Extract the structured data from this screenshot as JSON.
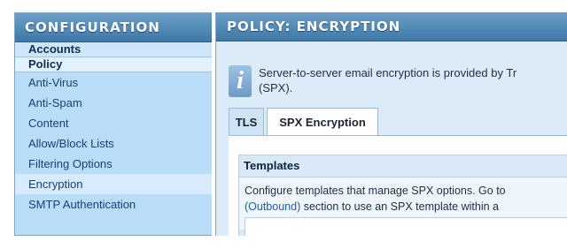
{
  "sidebar": {
    "title": "CONFIGURATION",
    "sections": [
      {
        "label": "Accounts"
      },
      {
        "label": "Policy"
      }
    ],
    "items": [
      {
        "label": "Anti-Virus"
      },
      {
        "label": "Anti-Spam"
      },
      {
        "label": "Content"
      },
      {
        "label": "Allow/Block Lists"
      },
      {
        "label": "Filtering Options"
      },
      {
        "label": "Encryption",
        "selected": true
      },
      {
        "label": "SMTP Authentication"
      }
    ]
  },
  "main": {
    "title": "POLICY: ENCRYPTION",
    "info": {
      "icon": "info-icon",
      "line1": "Server-to-server email encryption is provided by Tr",
      "line2": "(SPX)."
    },
    "tabs": [
      {
        "label": "TLS",
        "active": false
      },
      {
        "label": "SPX Encryption",
        "active": true
      }
    ],
    "templates": {
      "title": "Templates",
      "desc_line1": "Configure templates that manage SPX options. Go to",
      "desc_line2_link": "(Outbound)",
      "desc_line2_rest": " section to use an SPX template within a"
    }
  },
  "colors": {
    "header_blue": "#3e78a8",
    "sidebar_bg": "#b9dcf7",
    "link": "#1f5fb0"
  }
}
